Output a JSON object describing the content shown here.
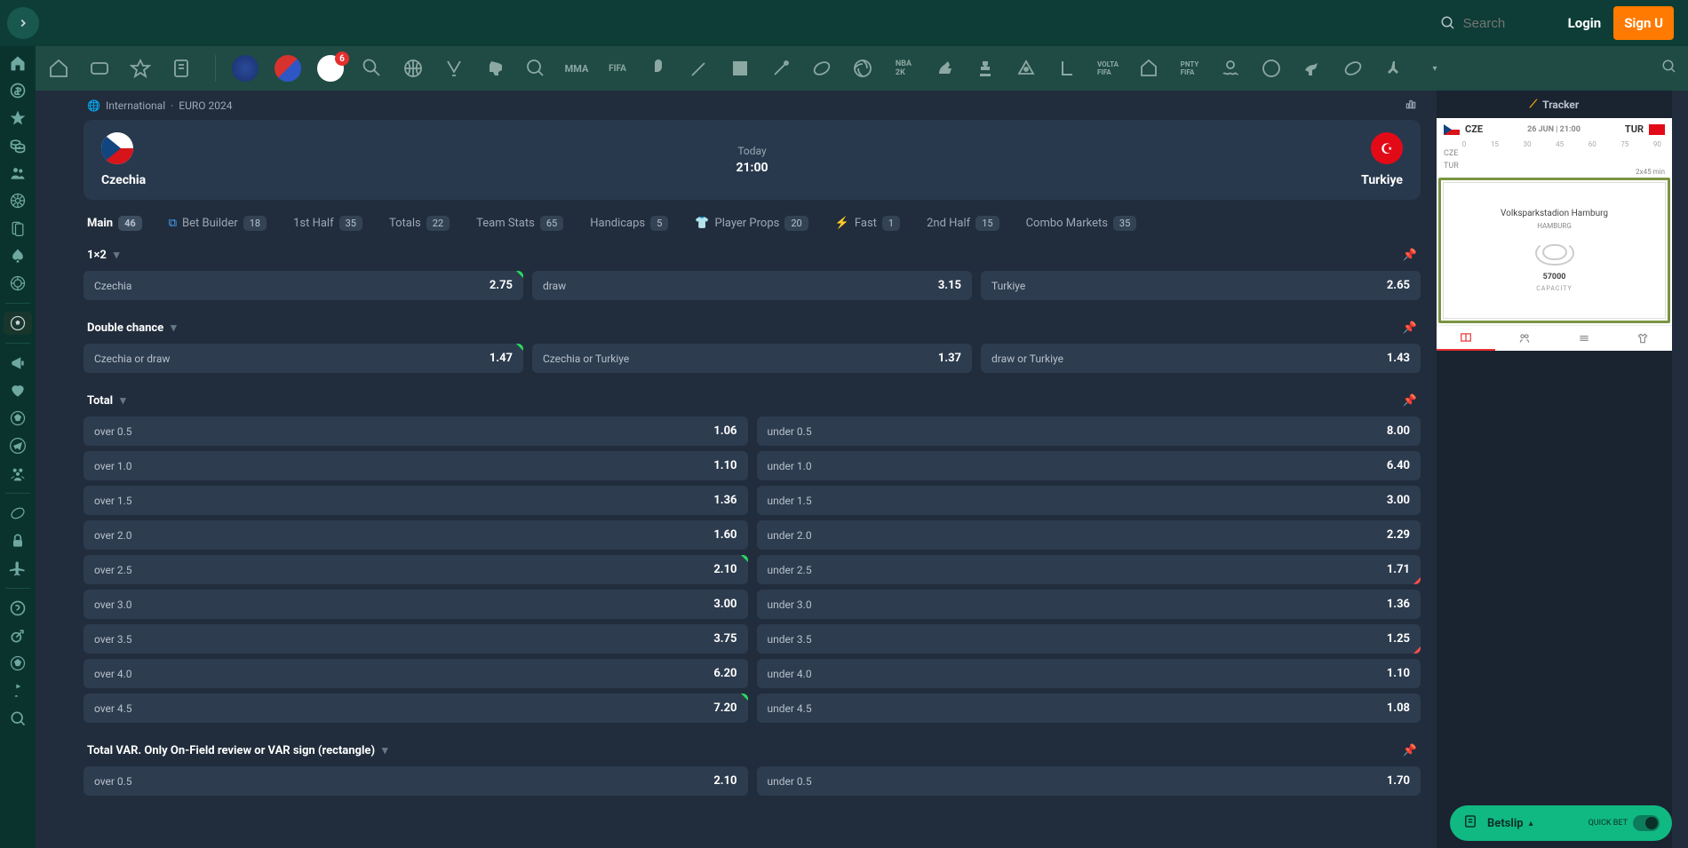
{
  "header": {
    "search_placeholder": "Search",
    "login": "Login",
    "signup": "Sign U"
  },
  "breadcrumb": {
    "globe": "🌐",
    "category": "International",
    "event": "EURO 2024"
  },
  "match": {
    "home": "Czechia",
    "away": "Turkiye",
    "day": "Today",
    "time": "21:00"
  },
  "tabs": [
    {
      "label": "Main",
      "count": "46",
      "icon": ""
    },
    {
      "label": "Bet Builder",
      "count": "18",
      "icon": "builder"
    },
    {
      "label": "1st Half",
      "count": "35",
      "icon": ""
    },
    {
      "label": "Totals",
      "count": "22",
      "icon": ""
    },
    {
      "label": "Team Stats",
      "count": "65",
      "icon": ""
    },
    {
      "label": "Handicaps",
      "count": "5",
      "icon": ""
    },
    {
      "label": "Player Props",
      "count": "20",
      "icon": "player"
    },
    {
      "label": "Fast",
      "count": "1",
      "icon": "bolt"
    },
    {
      "label": "2nd Half",
      "count": "15",
      "icon": ""
    },
    {
      "label": "Combo Markets",
      "count": "35",
      "icon": ""
    }
  ],
  "markets": {
    "one_x_two": {
      "title": "1×2",
      "cells": [
        {
          "label": "Czechia",
          "odds": "2.75",
          "up": true
        },
        {
          "label": "draw",
          "odds": "3.15"
        },
        {
          "label": "Turkiye",
          "odds": "2.65"
        }
      ]
    },
    "double_chance": {
      "title": "Double chance",
      "cells": [
        {
          "label": "Czechia or draw",
          "odds": "1.47",
          "up": true
        },
        {
          "label": "Czechia or Turkiye",
          "odds": "1.37"
        },
        {
          "label": "draw or Turkiye",
          "odds": "1.43"
        }
      ]
    },
    "total": {
      "title": "Total",
      "rows": [
        {
          "over_label": "over 0.5",
          "over_odds": "1.06",
          "under_label": "under 0.5",
          "under_odds": "8.00"
        },
        {
          "over_label": "over 1.0",
          "over_odds": "1.10",
          "under_label": "under 1.0",
          "under_odds": "6.40"
        },
        {
          "over_label": "over 1.5",
          "over_odds": "1.36",
          "under_label": "under 1.5",
          "under_odds": "3.00"
        },
        {
          "over_label": "over 2.0",
          "over_odds": "1.60",
          "under_label": "under 2.0",
          "under_odds": "2.29"
        },
        {
          "over_label": "over 2.5",
          "over_odds": "2.10",
          "over_up": true,
          "under_label": "under 2.5",
          "under_odds": "1.71",
          "under_down": true
        },
        {
          "over_label": "over 3.0",
          "over_odds": "3.00",
          "under_label": "under 3.0",
          "under_odds": "1.36"
        },
        {
          "over_label": "over 3.5",
          "over_odds": "3.75",
          "under_label": "under 3.5",
          "under_odds": "1.25",
          "under_down": true
        },
        {
          "over_label": "over 4.0",
          "over_odds": "6.20",
          "under_label": "under 4.0",
          "under_odds": "1.10"
        },
        {
          "over_label": "over 4.5",
          "over_odds": "7.20",
          "over_up": true,
          "under_label": "under 4.5",
          "under_odds": "1.08"
        }
      ]
    },
    "var": {
      "title": "Total VAR. Only On-Field review or VAR sign (rectangle)",
      "rows": [
        {
          "over_label": "over 0.5",
          "over_odds": "2.10",
          "under_label": "under 0.5",
          "under_odds": "1.70"
        }
      ]
    }
  },
  "tracker": {
    "title": "Tracker",
    "home_code": "CZE",
    "away_code": "TUR",
    "date": "26 JUN | 21:00",
    "ticks": [
      "0",
      "15",
      "30",
      "45",
      "60",
      "75",
      "90"
    ],
    "duration": "2x45 min",
    "stadium": "Volksparkstadion Hamburg",
    "city": "HAMBURG",
    "capacity": "57000",
    "capacity_label": "CAPACITY"
  },
  "betslip": {
    "label": "Betslip",
    "quick": "QUICK BET"
  }
}
